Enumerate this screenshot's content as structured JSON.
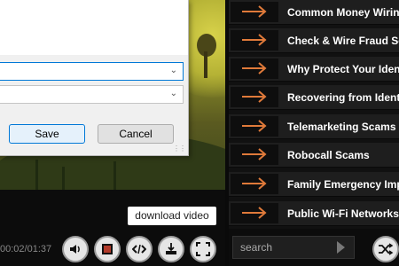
{
  "dialog": {
    "save_label": "Save",
    "cancel_label": "Cancel"
  },
  "player": {
    "timecode": "00:02/01:37",
    "tooltip": "download video",
    "controls": [
      {
        "name": "volume-button",
        "icon": "speaker-icon"
      },
      {
        "name": "stop-button",
        "icon": "stop-icon"
      },
      {
        "name": "embed-button",
        "icon": "code-icon"
      },
      {
        "name": "download-button",
        "icon": "download-icon"
      },
      {
        "name": "fullscreen-button",
        "icon": "fullscreen-icon"
      }
    ]
  },
  "playlist": {
    "items": [
      {
        "label": "Common Money Wiring"
      },
      {
        "label": "Check & Wire Fraud Sca"
      },
      {
        "label": "Why Protect Your Identi"
      },
      {
        "label": "Recovering from Identity"
      },
      {
        "label": "Telemarketing Scams"
      },
      {
        "label": "Robocall Scams"
      },
      {
        "label": "Family Emergency Impo"
      },
      {
        "label": "Public Wi-Fi Networks"
      }
    ],
    "arrow_color": "#e07a3a"
  },
  "search": {
    "placeholder": "search"
  },
  "colors": {
    "accent": "#0078d7",
    "panel": "#1e1e1e"
  }
}
